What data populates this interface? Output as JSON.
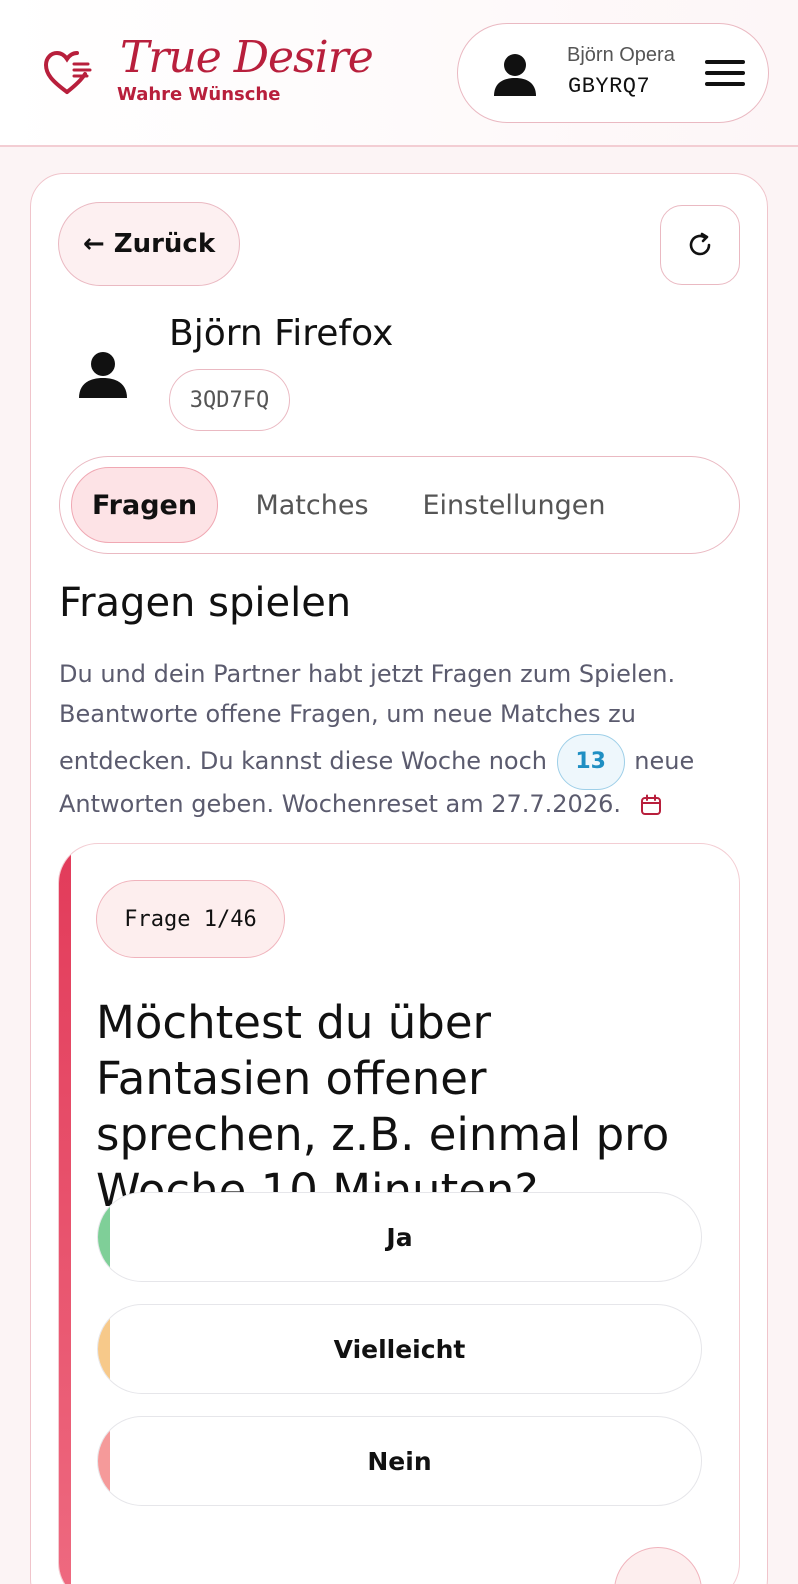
{
  "header": {
    "logo_title": "True Desire",
    "logo_subtitle": "Wahre Wünsche",
    "user_name": "Björn Opera",
    "user_code": "GBYRQ7"
  },
  "nav": {
    "back_label": "← Zurück"
  },
  "partner": {
    "name": "Björn Firefox",
    "code": "3QD7FQ"
  },
  "tabs": [
    {
      "label": "Fragen",
      "active": true
    },
    {
      "label": "Matches",
      "active": false
    },
    {
      "label": "Einstellungen",
      "active": false
    }
  ],
  "section": {
    "title": "Fragen spielen",
    "desc_line1": "Du und dein Partner habt jetzt Fragen zum Spielen.",
    "desc_line2": "Beantworte offene Fragen, um neue Matches zu",
    "desc_line3_pre": "entdecken. Du kannst diese Woche noch",
    "remaining_answers": "13",
    "desc_line3_post": "neue",
    "desc_line4": "Antworten geben. Wochenreset am 27.7.2026."
  },
  "question": {
    "counter": "Frage 1/46",
    "text": "Möchtest du über Fantasien offener sprechen, z.B. einmal pro Woche 10 Minuten?",
    "answers": [
      {
        "label": "Ja",
        "color": "#7fcf98"
      },
      {
        "label": "Vielleicht",
        "color": "#f7c98a"
      },
      {
        "label": "Nein",
        "color": "#f59a9a"
      }
    ]
  },
  "colors": {
    "brand": "#b81f3c",
    "accent_stripe": "#e23b5a",
    "badge_blue": "#1f8fc3"
  },
  "icons": {
    "logo": "heart-icon",
    "user": "user-icon",
    "menu": "hamburger-menu-icon",
    "refresh": "refresh-icon",
    "calendar": "calendar-icon"
  }
}
